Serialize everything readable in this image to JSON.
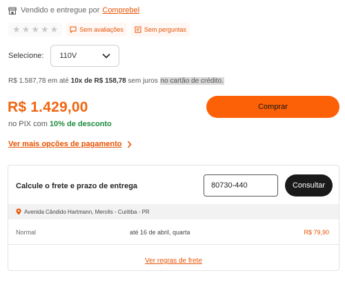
{
  "seller": {
    "text": "Vendido e entregue por",
    "name": "Comprebel",
    "icon": "store-icon"
  },
  "ratings": {
    "stars": [
      "★",
      "★",
      "★",
      "★",
      "★"
    ],
    "no_reviews": "Sem avaliações",
    "no_questions": "Sem perguntas"
  },
  "variant": {
    "label": "Selecione:",
    "selected": "110V"
  },
  "installments": {
    "total": "R$ 1.587,78",
    "mid1": "em até",
    "count": "10x de R$ 158,78",
    "mid2": "sem juros",
    "highlight": "no cartão de crédito."
  },
  "price": {
    "value": "R$ 1.429,00",
    "pix_prefix": "no PIX com",
    "pix_discount": "10% de desconto"
  },
  "buy_label": "Comprar",
  "more_payment": "Ver mais opções de pagamento",
  "frete": {
    "title": "Calcule o frete e prazo de entrega",
    "cep": "80730-440",
    "consult_label": "Consultar",
    "address": "Avenida Cândido Hartmann, Mercês - Curitiba - PR",
    "rows": [
      {
        "method": "Normal",
        "eta": "até 16 de abril, quarta",
        "cost": "R$ 79,90"
      }
    ],
    "rules_link": "Ver regras de frete"
  },
  "colors": {
    "accent": "#fd6108",
    "link": "#e65100",
    "pix_green": "#1e8a3b",
    "dark_button": "#1a1a1a"
  }
}
